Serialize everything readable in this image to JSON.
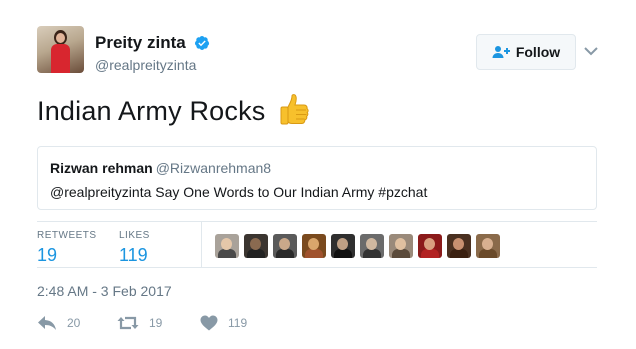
{
  "author": {
    "display_name": "Preity zinta",
    "handle": "@realpreityzinta",
    "verified": true
  },
  "follow_button": {
    "label": "Follow"
  },
  "tweet": {
    "text": "Indian Army Rocks",
    "emoji": "thumbs-up-icon"
  },
  "quote": {
    "name": "Rizwan rehman",
    "handle": "@Rizwanrehman8",
    "text": "@realpreityzinta Say One Words to Our Indian Army #pzchat"
  },
  "stats": {
    "retweets_label": "RETWEETS",
    "retweets": "19",
    "likes_label": "LIKES",
    "likes": "119"
  },
  "likers": [
    {
      "bg": "#a9a29a",
      "face": "#e5c7a9",
      "shirt": "#4a4a4a"
    },
    {
      "bg": "#3b3530",
      "face": "#8a6a50",
      "shirt": "#222222"
    },
    {
      "bg": "#5a5a5a",
      "face": "#c9a88a",
      "shirt": "#2a2a2a"
    },
    {
      "bg": "#7a4a1e",
      "face": "#d9a66c",
      "shirt": "#a0522d"
    },
    {
      "bg": "#2f2f2f",
      "face": "#bfa085",
      "shirt": "#111111"
    },
    {
      "bg": "#6b6b6b",
      "face": "#d0b8a0",
      "shirt": "#333333"
    },
    {
      "bg": "#9a8a7a",
      "face": "#e0c0a0",
      "shirt": "#5a4a3a"
    },
    {
      "bg": "#8b1a1a",
      "face": "#d9a080",
      "shirt": "#b22222"
    },
    {
      "bg": "#4a3020",
      "face": "#c89070",
      "shirt": "#3a2010"
    },
    {
      "bg": "#8a6a4a",
      "face": "#d8b090",
      "shirt": "#6a4a2a"
    }
  ],
  "timestamp": "2:48 AM - 3 Feb 2017",
  "actions": {
    "replies": "20",
    "retweets": "19",
    "likes": "119"
  },
  "colors": {
    "accent": "#1b95e0",
    "secondary": "#657786",
    "border": "#e1e8ed"
  }
}
